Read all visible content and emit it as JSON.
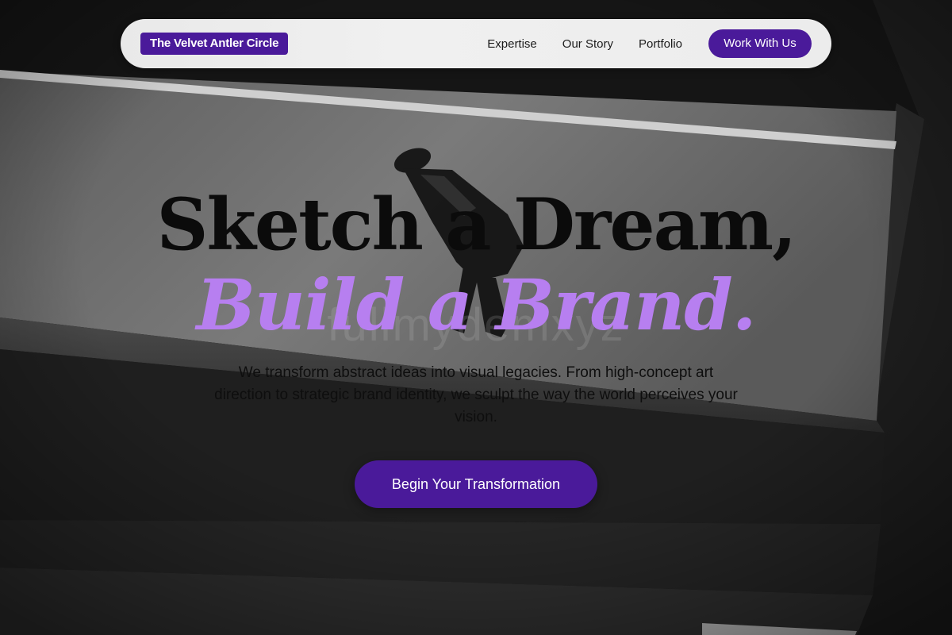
{
  "nav": {
    "brand": "The Velvet Antler Circle",
    "links": [
      "Expertise",
      "Our Story",
      "Portfolio"
    ],
    "cta": "Work With Us"
  },
  "hero": {
    "title_line1": "Sketch a Dream,",
    "title_line2": "Build a Brand.",
    "background_overlay_text": "fullmydemxyz",
    "subtitle": "We transform abstract ideas into visual legacies. From high-concept art direction to strategic brand identity, we sculpt the way the world perceives your vision.",
    "cta": "Begin Your Transformation"
  },
  "colors": {
    "accent": "#4a1a9a",
    "headline_accent": "#b77ff0",
    "nav_background": "#ececec"
  }
}
